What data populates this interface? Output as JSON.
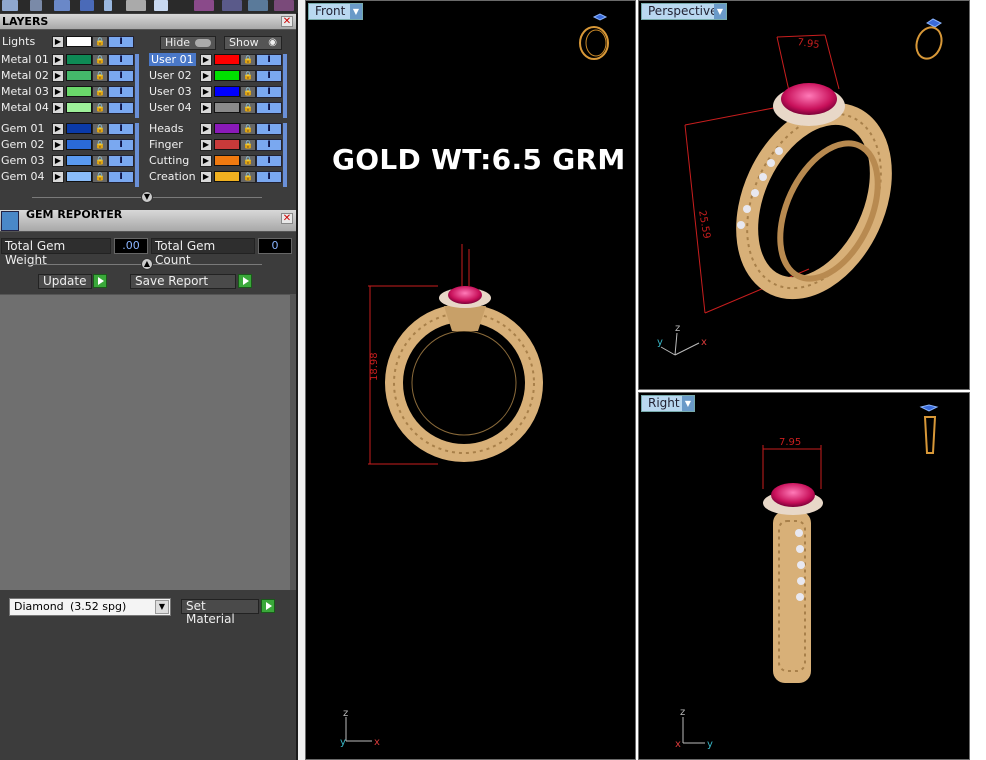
{
  "layers_panel": {
    "title": "LAYERS",
    "close_glyph": "✕",
    "lights_label": "Lights",
    "hide_label": "Hide",
    "show_label": "Show",
    "left_group_a": [
      {
        "label": "Metal 01",
        "color": "#0e8a55"
      },
      {
        "label": "Metal 02",
        "color": "#44b86a"
      },
      {
        "label": "Metal 03",
        "color": "#6ad86a"
      },
      {
        "label": "Metal 04",
        "color": "#9ef09a"
      }
    ],
    "left_group_b": [
      {
        "label": "Gem 01",
        "color": "#0a3aa8"
      },
      {
        "label": "Gem 02",
        "color": "#2a6ad8"
      },
      {
        "label": "Gem 03",
        "color": "#5a9af0"
      },
      {
        "label": "Gem 04",
        "color": "#8abcf8"
      }
    ],
    "right_group_a": [
      {
        "label": "User 01",
        "color": "#ff0000",
        "active": true
      },
      {
        "label": "User 02",
        "color": "#00e000"
      },
      {
        "label": "User 03",
        "color": "#0000ff"
      },
      {
        "label": "User 04",
        "color": "#8a8a8a"
      }
    ],
    "right_group_b": [
      {
        "label": "Heads",
        "color": "#8a1ab8"
      },
      {
        "label": "Finger",
        "color": "#c83a3a"
      },
      {
        "label": "Cutting",
        "color": "#f07a10"
      },
      {
        "label": "Creation",
        "color": "#f0b020"
      }
    ]
  },
  "gem_reporter": {
    "title": "GEM REPORTER",
    "total_weight_label": "Total Gem Weight",
    "total_weight_value": ".00",
    "total_count_label": "Total Gem Count",
    "total_count_value": "0",
    "update_label": "Update",
    "save_report_label": "Save Report",
    "material_name": "Diamond",
    "material_spg": "(3.52 spg)",
    "set_material_label": "Set Material"
  },
  "viewports": {
    "front": {
      "tab": "Front",
      "annotation": "GOLD WT:6.5 GRM",
      "dim_height": "18.98"
    },
    "perspective": {
      "tab": "Perspective",
      "dim_top": "7.95",
      "dim_side": "25.59"
    },
    "right": {
      "tab": "Right",
      "dim_top": "7.95"
    }
  },
  "axes": {
    "x": "x",
    "y": "y",
    "z": "z"
  },
  "colors": {
    "panel_bg": "#3c3c3c",
    "viewport_bg": "#000000",
    "gold": "#d8b078",
    "ruby": "#e0207a",
    "dimension_red": "#c81e1e",
    "tab_blue": "#b9d8f0"
  }
}
